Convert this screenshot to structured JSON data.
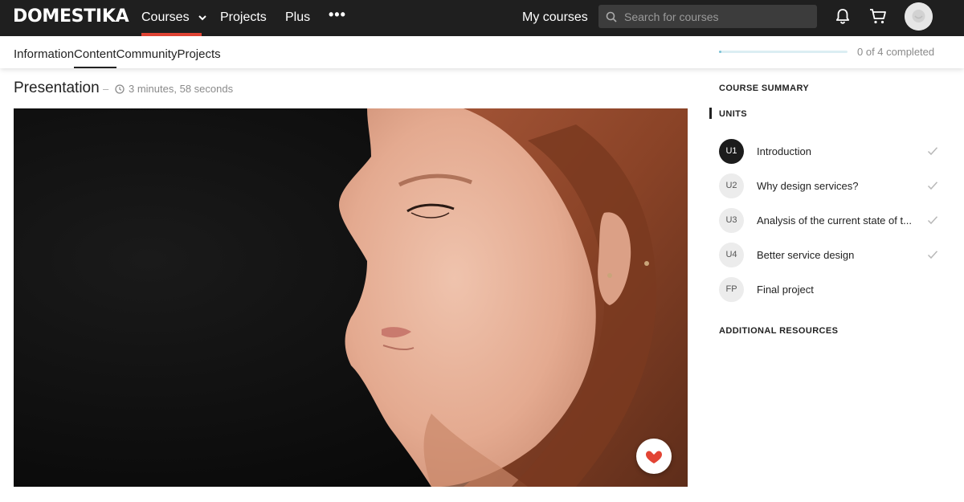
{
  "header": {
    "logo": "DOMESTIKA",
    "nav": {
      "courses": "Courses",
      "projects": "Projects",
      "plus": "Plus",
      "more": "•••",
      "my_courses": "My courses"
    },
    "search": {
      "placeholder": "Search for courses",
      "value": ""
    },
    "icons": [
      "search-icon",
      "bell-icon",
      "cart-icon",
      "avatar"
    ],
    "accent_color": "#e24434"
  },
  "subnav": {
    "tabs": [
      {
        "label": "Information",
        "active": false
      },
      {
        "label": "Content",
        "active": true
      },
      {
        "label": "Community",
        "active": false
      },
      {
        "label": "Projects",
        "active": false
      }
    ],
    "progress": {
      "text": "0 of 4 completed",
      "completed": 0,
      "total": 4,
      "fraction": 0.02
    }
  },
  "lesson": {
    "title": "Presentation",
    "separator": "–",
    "duration": "3 minutes, 58 seconds"
  },
  "sidebar": {
    "summary_heading": "COURSE SUMMARY",
    "units_heading": "UNITS",
    "units": [
      {
        "code": "U1",
        "label": "Introduction",
        "current": true,
        "checked": true
      },
      {
        "code": "U2",
        "label": "Why design services?",
        "current": false,
        "checked": true
      },
      {
        "code": "U3",
        "label": "Analysis of the current state of t...",
        "current": false,
        "checked": true
      },
      {
        "code": "U4",
        "label": "Better service design",
        "current": false,
        "checked": true
      },
      {
        "code": "FP",
        "label": "Final project",
        "current": false,
        "checked": false
      }
    ],
    "additional_heading": "ADDITIONAL RESOURCES"
  }
}
